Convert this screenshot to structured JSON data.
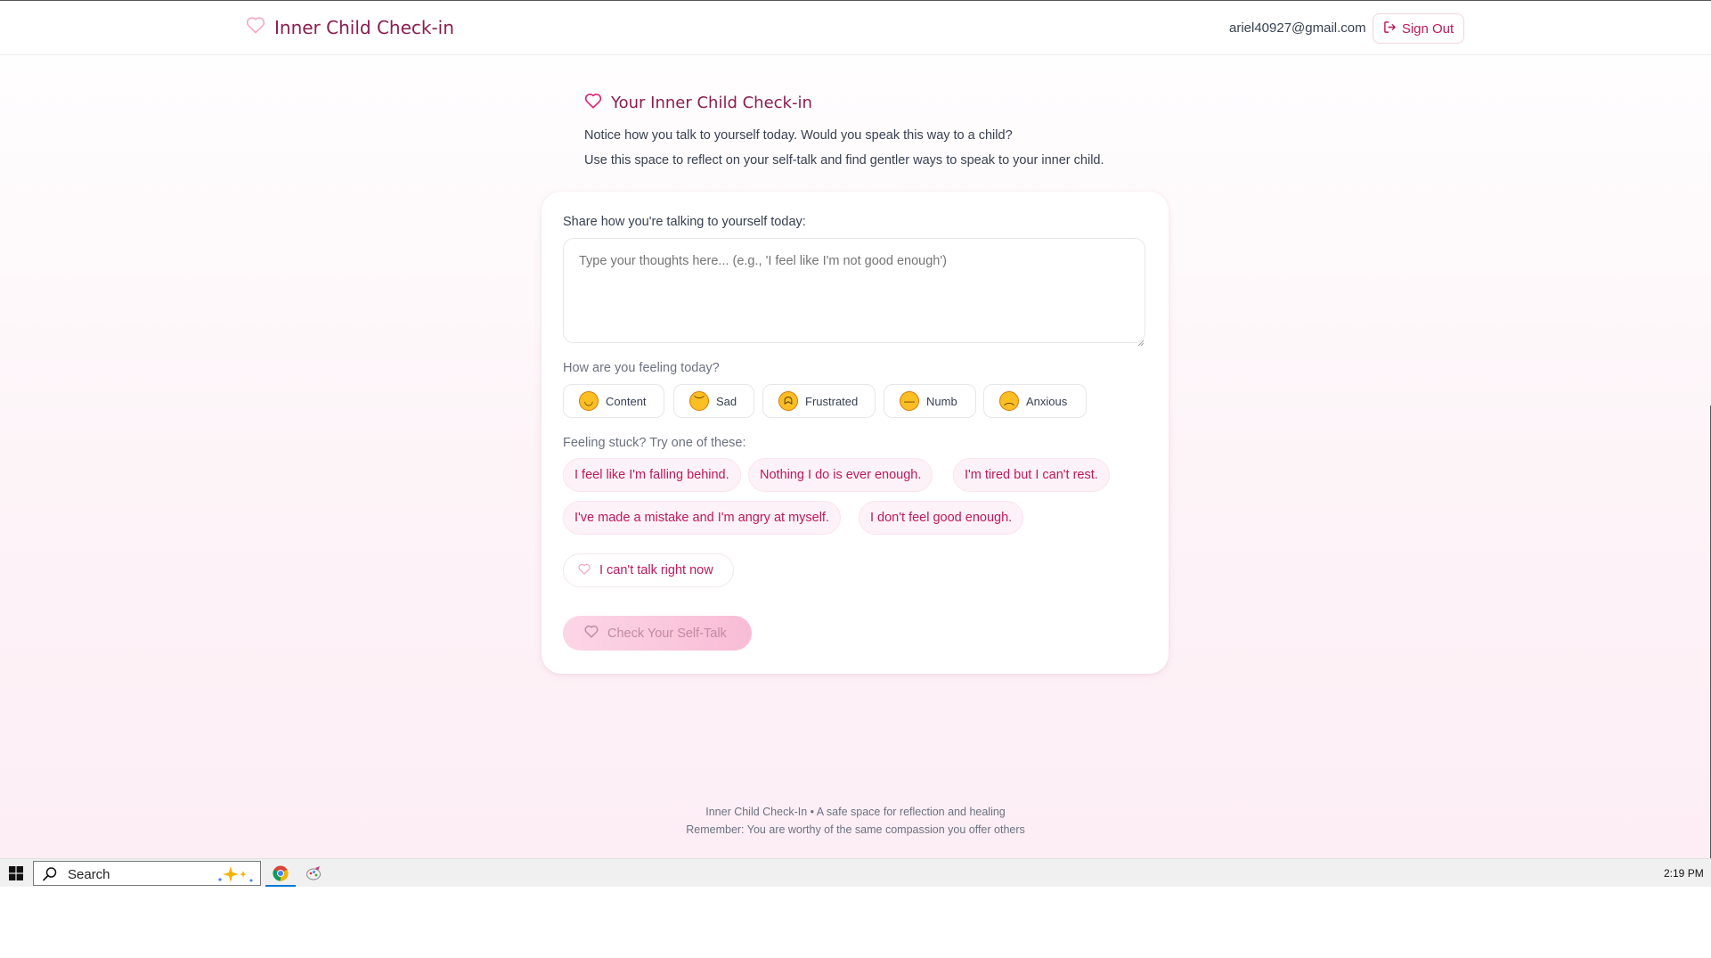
{
  "header": {
    "brand_title": "Inner Child Check-in",
    "brand_icon": "heart-outline-icon",
    "user_email": "ariel40927@gmail.com",
    "sign_out_label": "Sign Out"
  },
  "intro": {
    "title": "Your Inner Child Check-in",
    "line1": "Notice how you talk to yourself today. Would you speak this way to a child?",
    "line2": "Use this space to reflect on your self-talk and find gentler ways to speak to your inner child."
  },
  "form": {
    "prompt_label": "Share how you're talking to yourself today:",
    "textarea_value": "",
    "textarea_placeholder": "Type your thoughts here... (e.g., 'I feel like I'm not good enough')",
    "mood_label": "How are you feeling today?",
    "moods": [
      {
        "label": "Content",
        "emoji": "smiling-face-icon"
      },
      {
        "label": "Sad",
        "emoji": "pensive-face-icon"
      },
      {
        "label": "Frustrated",
        "emoji": "steaming-face-icon"
      },
      {
        "label": "Numb",
        "emoji": "neutral-face-icon"
      },
      {
        "label": "Anxious",
        "emoji": "worried-face-icon"
      }
    ],
    "stuck_label": "Feeling stuck? Try one of these:",
    "suggestions": [
      "I feel like I'm falling behind.",
      "Nothing I do is ever enough.",
      "I'm tired but I can't rest.",
      "I've made a mistake and I'm angry at myself.",
      "I don't feel good enough."
    ],
    "cant_talk_label": "I can't talk right now",
    "submit_label": "Check Your Self-Talk"
  },
  "footer": {
    "line1": "Inner Child Check-In • A safe space for reflection and healing",
    "line2": "Remember: You are worthy of the same compassion you offer others"
  },
  "taskbar": {
    "search_label": "Search",
    "clock": "2:19 PM"
  },
  "colors": {
    "accent": "#be185d",
    "brand_text": "#8b1d4f",
    "chip_bg": "#fdf2f7",
    "button_gradient_start": "#fcd6e6",
    "button_gradient_end": "#f9bcd6"
  }
}
